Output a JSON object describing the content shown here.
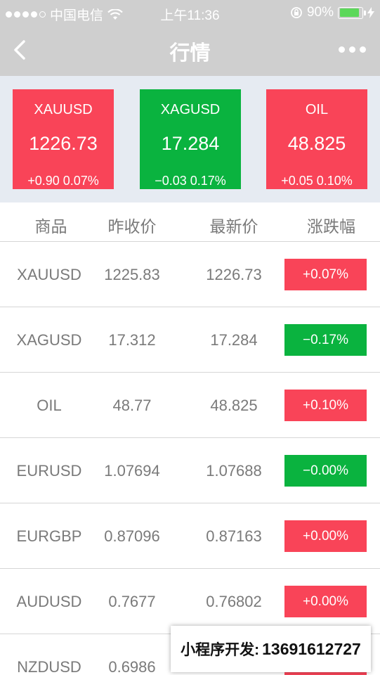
{
  "status": {
    "carrier": "中国电信",
    "time": "上午11:36",
    "battery": "90%",
    "battery_level": 0.9
  },
  "nav": {
    "title": "行情"
  },
  "cards": [
    {
      "symbol": "XAUUSD",
      "price": "1226.73",
      "change": "+0.90",
      "percent": "0.07%",
      "trend": "up"
    },
    {
      "symbol": "XAGUSD",
      "price": "17.284",
      "change": "−0.03",
      "percent": "0.17%",
      "trend": "down"
    },
    {
      "symbol": "OIL",
      "price": "48.825",
      "change": "+0.05",
      "percent": "0.10%",
      "trend": "up"
    }
  ],
  "table": {
    "headers": [
      "商品",
      "昨收价",
      "最新价",
      "涨跌幅"
    ],
    "rows": [
      {
        "symbol": "XAUUSD",
        "prev_close": "1225.83",
        "latest": "1226.73",
        "change": "+0.07%",
        "trend": "up"
      },
      {
        "symbol": "XAGUSD",
        "prev_close": "17.312",
        "latest": "17.284",
        "change": "−0.17%",
        "trend": "down"
      },
      {
        "symbol": "OIL",
        "prev_close": "48.77",
        "latest": "48.825",
        "change": "+0.10%",
        "trend": "up"
      },
      {
        "symbol": "EURUSD",
        "prev_close": "1.07694",
        "latest": "1.07688",
        "change": "−0.00%",
        "trend": "down"
      },
      {
        "symbol": "EURGBP",
        "prev_close": "0.87096",
        "latest": "0.87163",
        "change": "+0.00%",
        "trend": "up"
      },
      {
        "symbol": "AUDUSD",
        "prev_close": "0.7677",
        "latest": "0.76802",
        "change": "+0.00%",
        "trend": "up"
      },
      {
        "symbol": "NZDUSD",
        "prev_close": "0.6986",
        "latest": "",
        "change": "",
        "trend": "up"
      }
    ]
  },
  "watermark": {
    "label": "小程序开发:",
    "phone": "13691612727"
  },
  "colors": {
    "up": "#f94458",
    "down": "#0ab33f",
    "header_bg": "#cfcfcf",
    "cards_bg": "#e6ebf2"
  }
}
